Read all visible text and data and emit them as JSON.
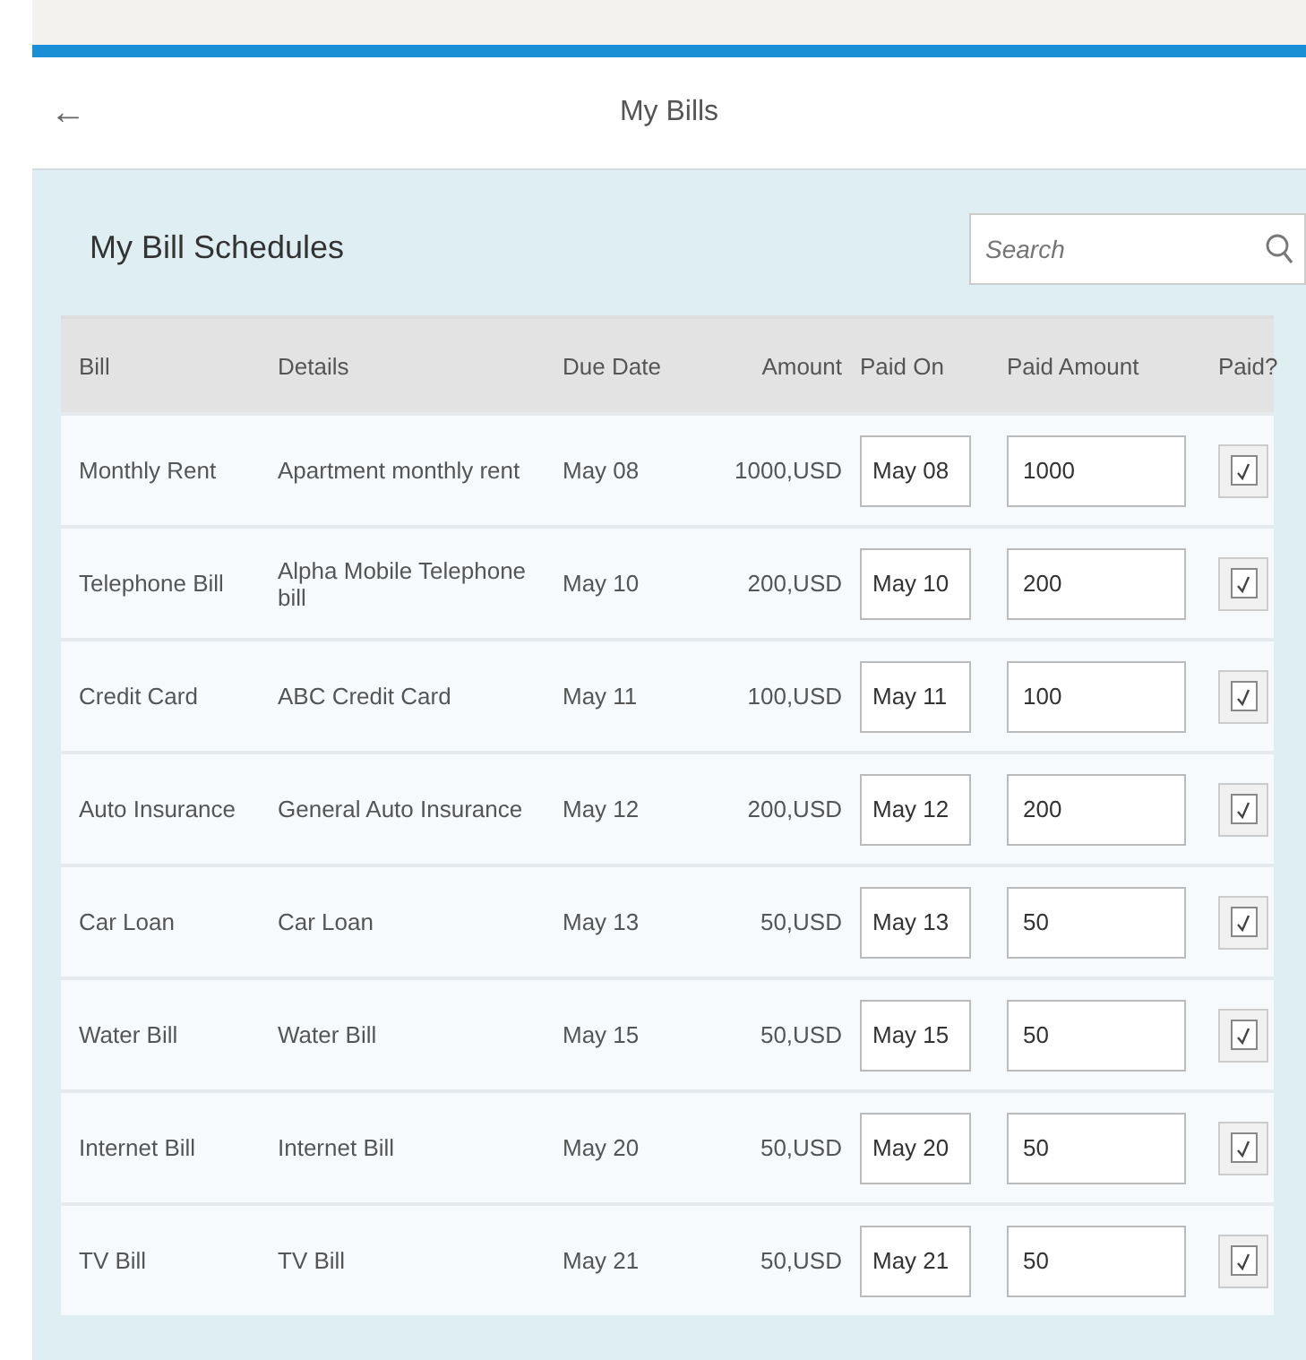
{
  "header": {
    "back_icon": "←",
    "title": "My Bills"
  },
  "panel": {
    "title": "My Bill Schedules",
    "search": {
      "placeholder": "Search"
    }
  },
  "table": {
    "columns": [
      "Bill",
      "Details",
      "Due Date",
      "Amount",
      "Paid On",
      "Paid Amount",
      "Paid?"
    ],
    "rows": [
      {
        "bill": "Monthly Rent",
        "details": "Apartment monthly rent",
        "due_date": "May 08",
        "amount": "1000,USD",
        "paid_on": "May 08",
        "paid_amount": "1000",
        "paid": true
      },
      {
        "bill": "Telephone Bill",
        "details": "Alpha Mobile Telephone bill",
        "due_date": "May 10",
        "amount": "200,USD",
        "paid_on": "May 10",
        "paid_amount": "200",
        "paid": true
      },
      {
        "bill": "Credit Card",
        "details": "ABC Credit Card",
        "due_date": "May 11",
        "amount": "100,USD",
        "paid_on": "May 11",
        "paid_amount": "100",
        "paid": true
      },
      {
        "bill": "Auto Insurance",
        "details": "General Auto Insurance",
        "due_date": "May 12",
        "amount": "200,USD",
        "paid_on": "May 12",
        "paid_amount": "200",
        "paid": true
      },
      {
        "bill": "Car Loan",
        "details": "Car Loan",
        "due_date": "May 13",
        "amount": "50,USD",
        "paid_on": "May 13",
        "paid_amount": "50",
        "paid": true
      },
      {
        "bill": "Water Bill",
        "details": "Water Bill",
        "due_date": "May 15",
        "amount": "50,USD",
        "paid_on": "May 15",
        "paid_amount": "50",
        "paid": true
      },
      {
        "bill": "Internet Bill",
        "details": "Internet Bill",
        "due_date": "May 20",
        "amount": "50,USD",
        "paid_on": "May 20",
        "paid_amount": "50",
        "paid": true
      },
      {
        "bill": "TV Bill",
        "details": "TV Bill",
        "due_date": "May 21",
        "amount": "50,USD",
        "paid_on": "May 21",
        "paid_amount": "50",
        "paid": true
      }
    ]
  }
}
